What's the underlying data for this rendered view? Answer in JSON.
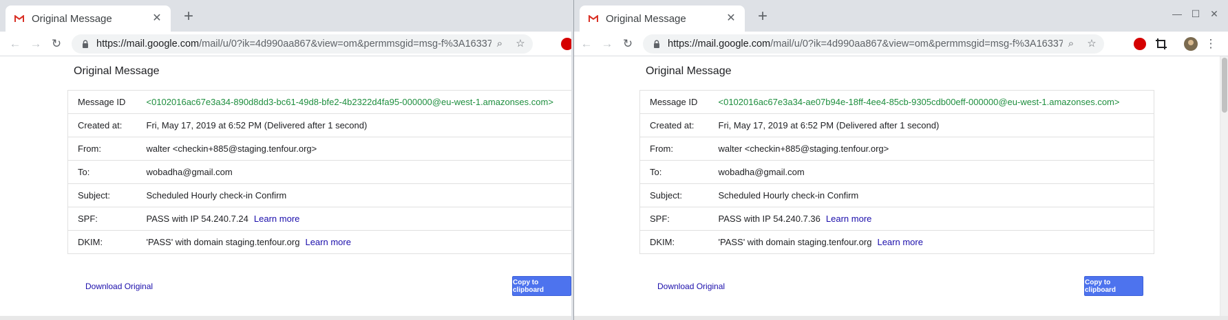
{
  "left": {
    "tab_title": "Original Message",
    "url_host": "https://mail.google.com",
    "url_path": "/mail/u/0?ik=4d990aa867&view=om&permmsgid=msg-f%3A16337…",
    "page_title": "Original Message",
    "rows": [
      {
        "key": "Message ID",
        "value": "<0102016ac67e3a34-890d8dd3-bc61-49d8-bfe2-4b2322d4fa95-000000@eu-west-1.amazonses.com>"
      },
      {
        "key": "Created at:",
        "value": "Fri, May 17, 2019 at 6:52 PM (Delivered after 1 second)"
      },
      {
        "key": "From:",
        "value": "walter <checkin+885@staging.tenfour.org>"
      },
      {
        "key": "To:",
        "value": "wobadha@gmail.com"
      },
      {
        "key": "Subject:",
        "value": "Scheduled Hourly check-in Confirm"
      },
      {
        "key": "SPF:",
        "value": "PASS with IP 54.240.7.24",
        "link": "Learn more"
      },
      {
        "key": "DKIM:",
        "value": "'PASS' with domain staging.tenfour.org",
        "link": "Learn more"
      }
    ],
    "download_label": "Download Original",
    "copy_label": "Copy to clipboard"
  },
  "right": {
    "tab_title": "Original Message",
    "url_host": "https://mail.google.com",
    "url_path": "/mail/u/0?ik=4d990aa867&view=om&permmsgid=msg-f%3A16337…",
    "page_title": "Original Message",
    "rows": [
      {
        "key": "Message ID",
        "value": "<0102016ac67e3a34-ae07b94e-18ff-4ee4-85cb-9305cdb00eff-000000@eu-west-1.amazonses.com>"
      },
      {
        "key": "Created at:",
        "value": "Fri, May 17, 2019 at 6:52 PM (Delivered after 1 second)"
      },
      {
        "key": "From:",
        "value": "walter <checkin+885@staging.tenfour.org>"
      },
      {
        "key": "To:",
        "value": "wobadha@gmail.com"
      },
      {
        "key": "Subject:",
        "value": "Scheduled Hourly check-in Confirm"
      },
      {
        "key": "SPF:",
        "value": "PASS with IP 54.240.7.36",
        "link": "Learn more"
      },
      {
        "key": "DKIM:",
        "value": "'PASS' with domain staging.tenfour.org",
        "link": "Learn more"
      }
    ],
    "download_label": "Download Original",
    "copy_label": "Copy to clipboard"
  },
  "icons": {
    "tab": "gmail-icon",
    "close": "close-icon",
    "new_tab": "plus-icon",
    "back": "back-arrow-icon",
    "forward": "forward-arrow-icon",
    "reload": "reload-icon",
    "lock": "lock-icon",
    "zoom": "zoom-icon",
    "bookmark": "star-icon"
  },
  "colors": {
    "message_id": "#1e8e3e",
    "link": "#1a0dab",
    "copy_button": "#4d73ee"
  }
}
